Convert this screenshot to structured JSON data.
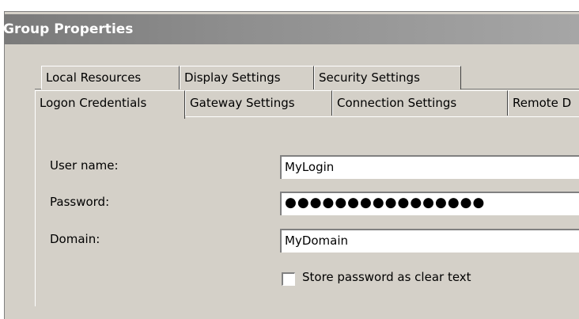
{
  "window": {
    "title": "Group Properties"
  },
  "tabs": {
    "back_row": [
      {
        "label": "Local Resources"
      },
      {
        "label": "Display Settings"
      },
      {
        "label": "Security Settings"
      }
    ],
    "front_row": [
      {
        "label": "Logon Credentials",
        "active": true
      },
      {
        "label": "Gateway Settings"
      },
      {
        "label": "Connection Settings"
      },
      {
        "label": "Remote D"
      }
    ]
  },
  "form": {
    "username": {
      "label": "User name:",
      "value": "MyLogin"
    },
    "password": {
      "label": "Password:",
      "value": "●●●●●●●●●●●●●●●●"
    },
    "domain": {
      "label": "Domain:",
      "value": "MyDomain"
    },
    "store_clear": {
      "label": "Store password as clear text",
      "checked": false
    }
  }
}
